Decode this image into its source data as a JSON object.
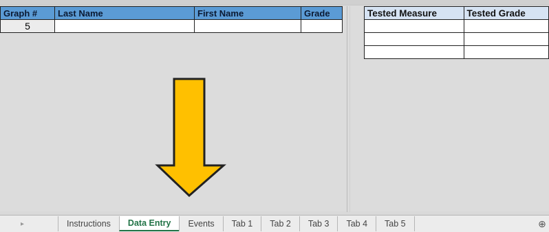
{
  "table_left": {
    "headers": [
      "Graph #",
      "Last Name",
      "First Name",
      "Grade"
    ],
    "row": [
      "5",
      "",
      "",
      ""
    ]
  },
  "table_right": {
    "headers": [
      "Tested Measure",
      "Tested Grade"
    ],
    "rows": [
      [
        "",
        ""
      ],
      [
        "",
        ""
      ],
      [
        "",
        ""
      ]
    ]
  },
  "arrow": {
    "color": "#ffc000",
    "outline": "#222222",
    "icon": "down-arrow-icon"
  },
  "sheet_tabs": {
    "nav_glyph": "▸",
    "tabs": [
      "Instructions",
      "Data Entry",
      "Events",
      "Tab 1",
      "Tab 2",
      "Tab 3",
      "Tab 4",
      "Tab 5"
    ],
    "active": "Data Entry",
    "add_glyph": "⊕"
  }
}
